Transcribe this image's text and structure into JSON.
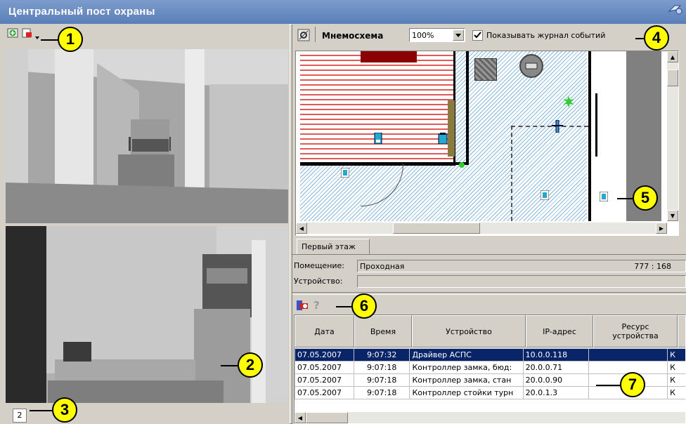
{
  "window": {
    "title": "Центральный пост охраны"
  },
  "callouts": [
    "1",
    "2",
    "3",
    "4",
    "5",
    "6",
    "7"
  ],
  "left_panel": {
    "camera_number": "2"
  },
  "map_toolbar": {
    "title": "Мнемосхема",
    "zoom": "100%",
    "show_log_label": "Показывать журнал событий",
    "show_log_checked": true
  },
  "floor_tab": "Первый этаж",
  "info": {
    "room_label": "Помещение:",
    "room_value": "Проходная",
    "coords": "777 : 168",
    "device_label": "Устройство:",
    "device_value": ""
  },
  "log": {
    "help_icon_text": "?",
    "columns": [
      "Дата",
      "Время",
      "Устройство",
      "IP-адрес",
      "Ресурс устройства",
      "К"
    ],
    "rows": [
      {
        "date": "07.05.2007",
        "time": "9:07:32",
        "device": "Драйвер АСПС",
        "ip": "10.0.0.118",
        "resource": "",
        "extra": "К",
        "selected": true
      },
      {
        "date": "07.05.2007",
        "time": "9:07:18",
        "device": "Контроллер замка, бюд:",
        "ip": "20.0.0.71",
        "resource": "",
        "extra": "К",
        "selected": false
      },
      {
        "date": "07.05.2007",
        "time": "9:07:18",
        "device": "Контроллер замка, стан",
        "ip": "20.0.0.90",
        "resource": "",
        "extra": "К",
        "selected": false
      },
      {
        "date": "07.05.2007",
        "time": "9:07:18",
        "device": "Контроллер стойки турн",
        "ip": "20.0.1.3",
        "resource": "",
        "extra": "К",
        "selected": false
      }
    ]
  },
  "colors": {
    "title_bar": "#6384bd",
    "callout": "#ffff00",
    "selection": "#0a246a",
    "map_hatch": "#88b8e0",
    "alarm_green": "#33cc33"
  }
}
